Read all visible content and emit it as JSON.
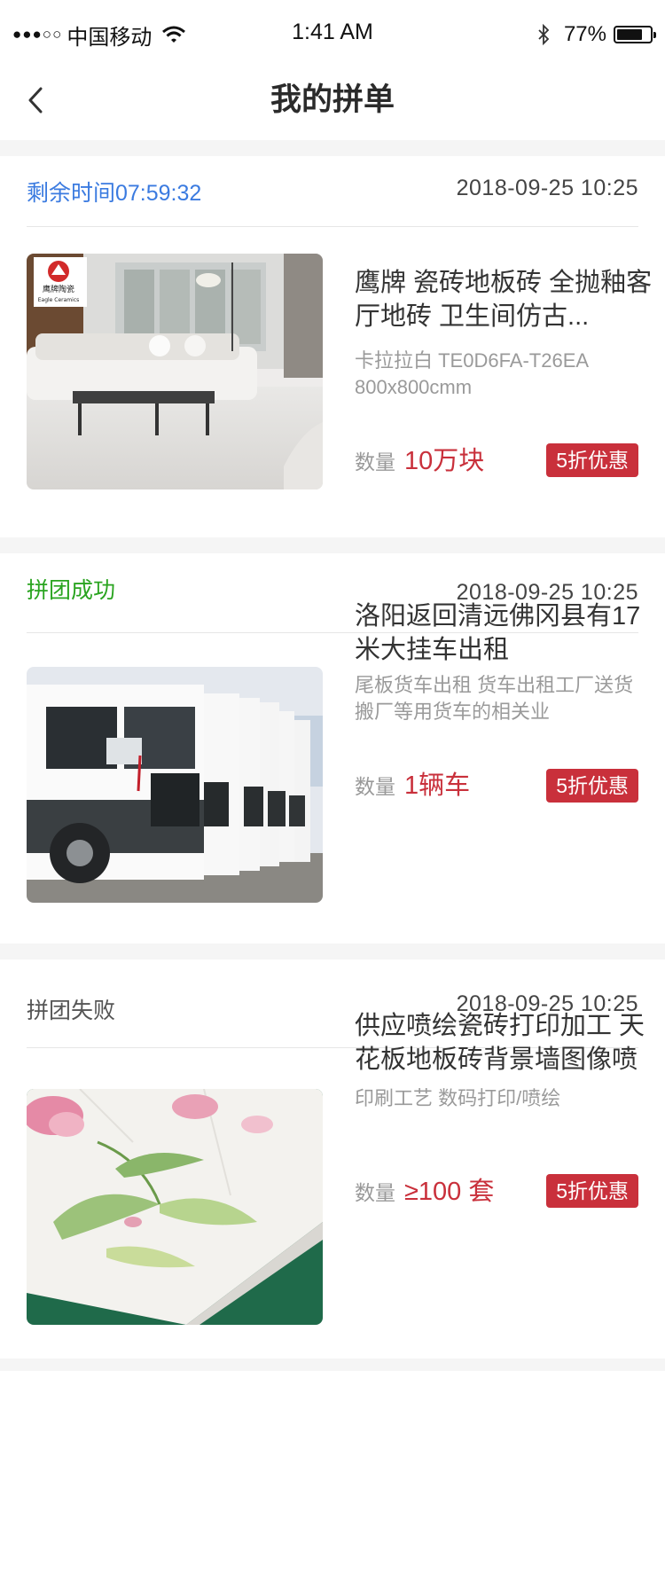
{
  "status_bar": {
    "signal": "●●●○○",
    "carrier": "中国移动",
    "time": "1:41 AM",
    "battery_text": "77%",
    "battery_level": 0.77
  },
  "nav": {
    "title": "我的拼单",
    "back_icon": "chevron-left-icon"
  },
  "orders": [
    {
      "status": "剩余时间07:59:32",
      "date": "2018-09-25   10:25",
      "title": "鹰牌 瓷砖地板砖 全抛釉客厅地砖 卫生间仿古...",
      "spec": "卡拉拉白 TE0D6FA-T26EA 800x800cmm",
      "qty_label": "数量",
      "qty_value": "10万块",
      "discount": "5折优惠",
      "image": {
        "logo_cn": "鹰牌陶瓷",
        "logo_en": "Eagle Ceramics"
      }
    },
    {
      "status": "拼团成功",
      "date": "2018-09-25   10:25",
      "title": "洛阳返回清远佛冈县有17米大挂车出租",
      "spec": "尾板货车出租 货车出租工厂送货 搬厂等用货车的相关业",
      "qty_label": "数量",
      "qty_value": "1辆车",
      "discount": "5折优惠"
    },
    {
      "status": "拼团失败",
      "date": "2018-09-25   10:25",
      "title": "供应喷绘瓷砖打印加工 天花板地板砖背景墙图像喷",
      "spec": "印刷工艺  数码打印/喷绘",
      "qty_label": "数量",
      "qty_value": "≥100 套",
      "discount": "5折优惠"
    }
  ],
  "colors": {
    "accent_red": "#c9303b",
    "status_blue": "#3b7be0",
    "status_green": "#2aa420",
    "status_gray": "#555555"
  }
}
